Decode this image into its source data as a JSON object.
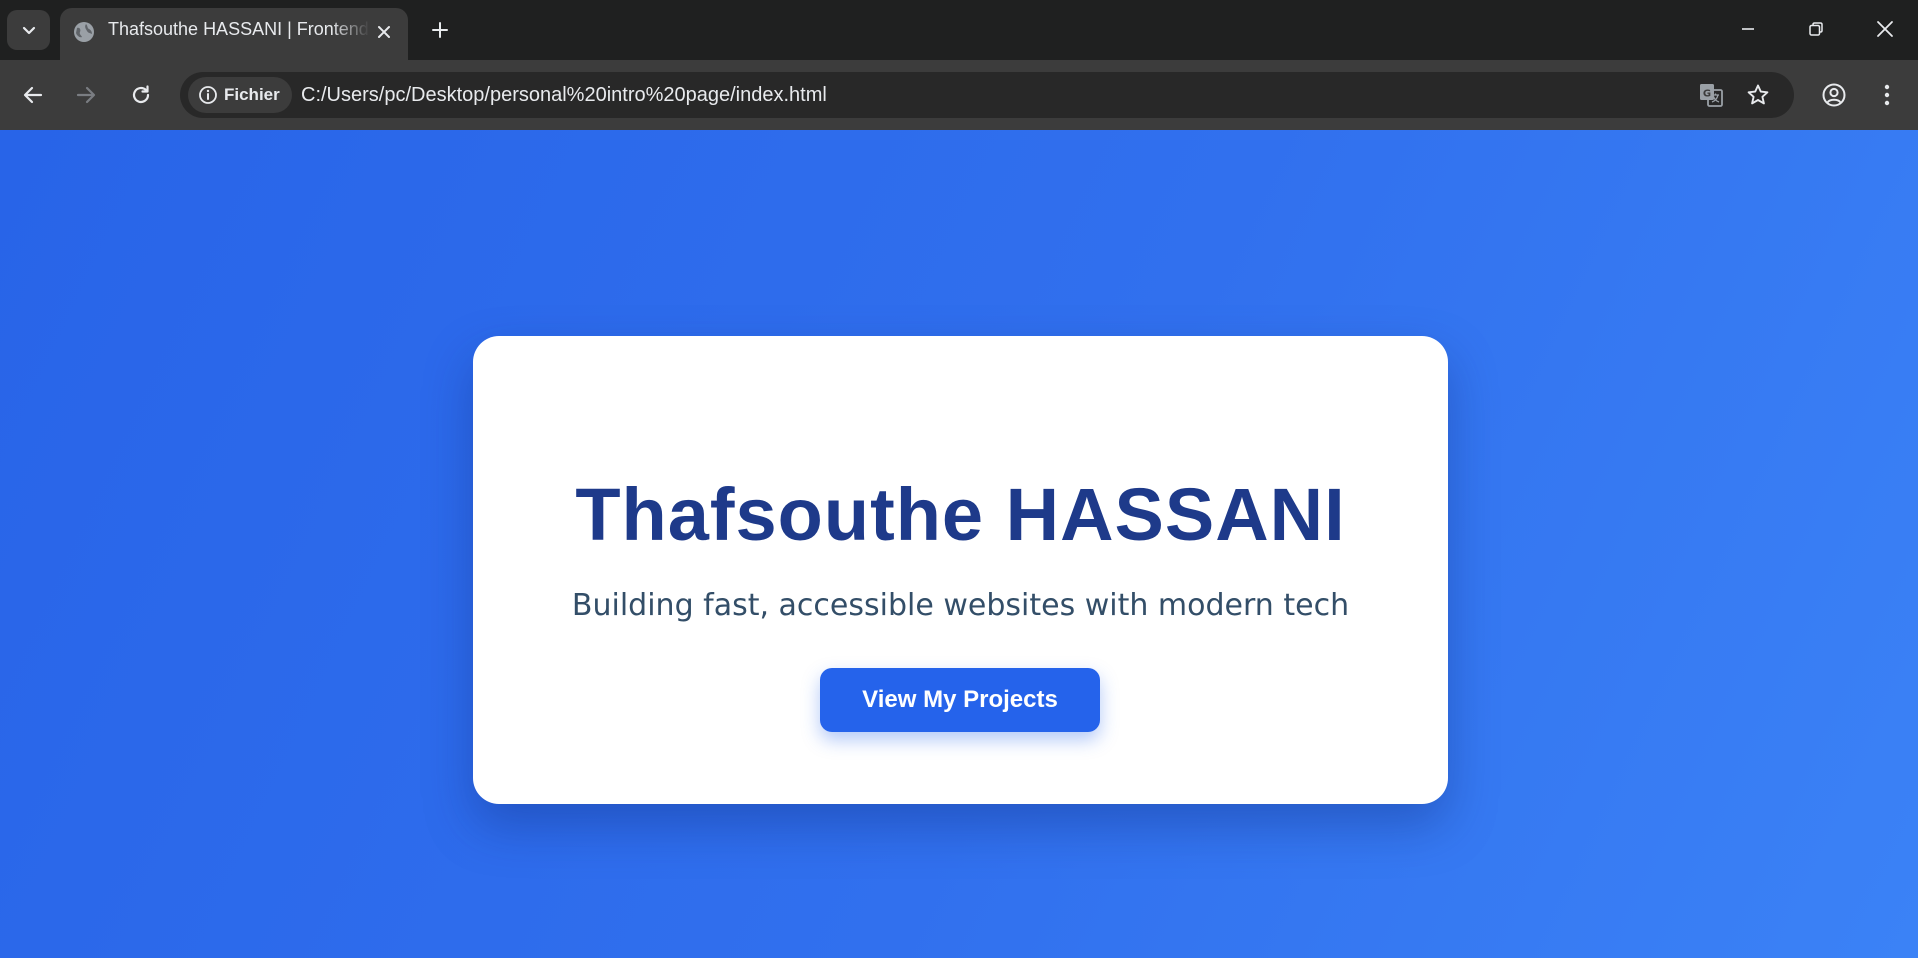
{
  "browser": {
    "tab": {
      "title": "Thafsouthe HASSANI | Frontend",
      "icon": "globe-icon"
    },
    "address_bar": {
      "security_chip_label": "Fichier",
      "url": "C:/Users/pc/Desktop/personal%20intro%20page/index.html"
    },
    "icons": [
      "tab-list-chevron-icon",
      "close-icon",
      "plus-icon",
      "minimize-icon",
      "restore-icon",
      "close-window-icon",
      "back-arrow-icon",
      "forward-arrow-icon",
      "reload-icon",
      "info-icon",
      "translate-icon",
      "star-icon",
      "profile-icon",
      "kebab-menu-icon"
    ]
  },
  "page": {
    "name": "Thafsouthe HASSANI",
    "tagline": "Building fast, accessible websites with modern tech",
    "cta_label": "View My Projects"
  },
  "colors": {
    "background_start": "#2864e8",
    "background_end": "#3b82f6",
    "card": "#ffffff",
    "name_text": "#1e3a8a",
    "tagline_text": "#334e68",
    "button": "#2563eb",
    "button_text": "#ffffff"
  }
}
